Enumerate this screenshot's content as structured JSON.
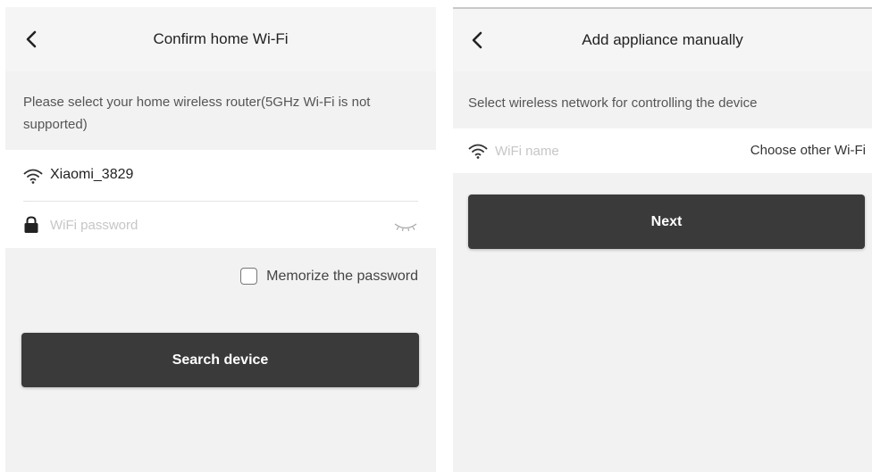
{
  "left_screen": {
    "title": "Confirm home Wi-Fi",
    "hint": "Please select your home wireless router(5GHz Wi-Fi is not supported)",
    "ssid": "Xiaomi_3829",
    "password_placeholder": "WiFi password",
    "memorize_label": "Memorize the password",
    "memorize_checked": false,
    "primary_button": "Search device"
  },
  "right_screen": {
    "title": "Add appliance manually",
    "hint": "Select wireless network for controlling the device",
    "wifi_name_placeholder": "WiFi name",
    "choose_other": "Choose other Wi-Fi",
    "primary_button": "Next"
  },
  "icons": {
    "back": "chevron-left-icon",
    "wifi": "wifi-icon",
    "lock": "lock-icon",
    "password_visibility": "eye-closed-icon"
  },
  "colors": {
    "button_bg": "#3a3a3a",
    "screen_bg": "#f2f2f2",
    "panel_bg": "#ffffff",
    "placeholder": "#c6c6c6"
  }
}
